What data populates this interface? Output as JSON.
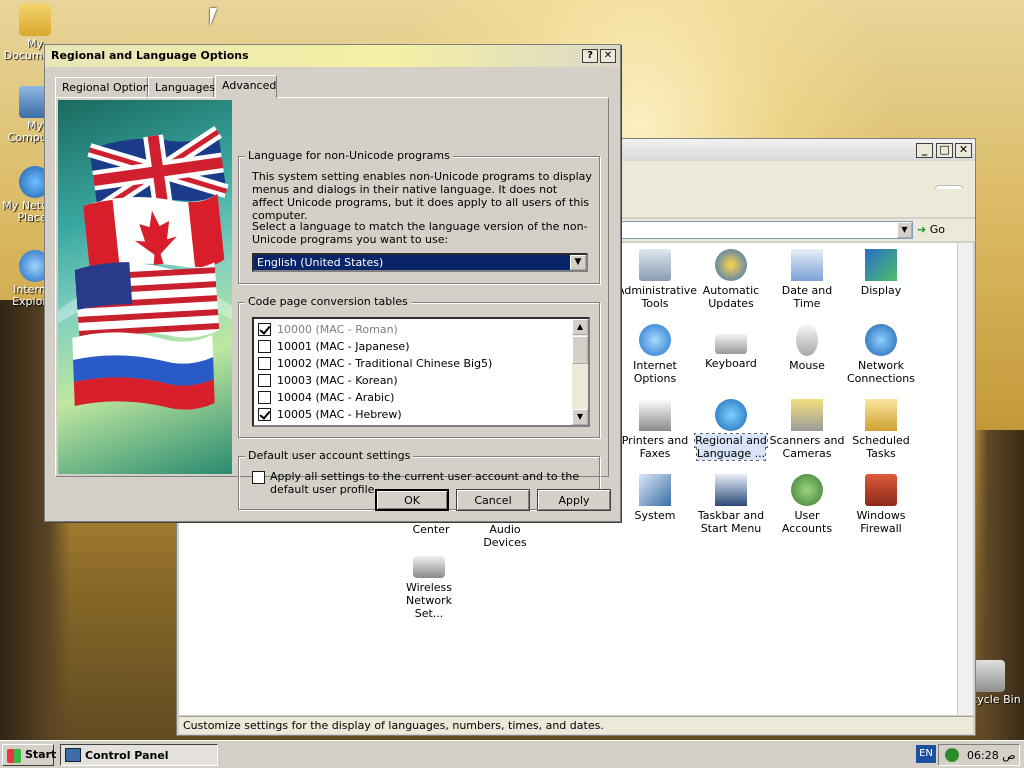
{
  "desktop": {
    "icons": [
      {
        "label": "My Documents",
        "icon": "folder-icon"
      },
      {
        "label": "My Computer",
        "icon": "computer-icon"
      },
      {
        "label": "My Network Places",
        "icon": "network-places-icon"
      },
      {
        "label": "Internet Explorer",
        "icon": "internet-explorer-icon"
      },
      {
        "label": "Recycle Bin",
        "icon": "recycle-bin-icon"
      }
    ]
  },
  "control_panel": {
    "title": "Control Panel",
    "address_go": "Go",
    "status_text": "Customize settings for the display of languages, numbers, times, and dates.",
    "items": [
      {
        "label": "Administrative Tools",
        "icon": "admin-tools-icon"
      },
      {
        "label": "Automatic Updates",
        "icon": "automatic-updates-icon"
      },
      {
        "label": "Date and Time",
        "icon": "date-time-icon"
      },
      {
        "label": "Display",
        "icon": "display-icon"
      },
      {
        "label": "Internet Options",
        "icon": "internet-options-icon"
      },
      {
        "label": "Keyboard",
        "icon": "keyboard-icon"
      },
      {
        "label": "Mouse",
        "icon": "mouse-icon"
      },
      {
        "label": "Network Connections",
        "icon": "network-connections-icon"
      },
      {
        "label": "Printers and Faxes",
        "icon": "printers-icon"
      },
      {
        "label": "Regional and Language ...",
        "icon": "regional-language-icon"
      },
      {
        "label": "Scanners and Cameras",
        "icon": "scanners-icon"
      },
      {
        "label": "Scheduled Tasks",
        "icon": "scheduled-tasks-icon"
      },
      {
        "label": "System",
        "icon": "system-icon"
      },
      {
        "label": "Taskbar and Start Menu",
        "icon": "taskbar-icon"
      },
      {
        "label": "User Accounts",
        "icon": "user-accounts-icon"
      },
      {
        "label": "Windows Firewall",
        "icon": "firewall-icon"
      },
      {
        "label": "Center",
        "icon": ""
      },
      {
        "label": "Audio Devices",
        "icon": ""
      },
      {
        "label": "Wireless Network Set...",
        "icon": "wireless-icon"
      }
    ]
  },
  "dialog": {
    "title": "Regional and Language Options",
    "help_btn": "?",
    "close_btn": "✕",
    "tabs": [
      "Regional Options",
      "Languages",
      "Advanced"
    ],
    "active_tab": "Advanced",
    "non_unicode": {
      "legend": "Language for non-Unicode programs",
      "desc": "This system setting enables non-Unicode programs to display menus and dialogs in their native language. It does not affect Unicode programs, but it does apply to all users of this computer.",
      "prompt": "Select a language to match the language version of the non-Unicode programs you want to use:",
      "selected": "English (United States)"
    },
    "code_page": {
      "legend": "Code page conversion tables",
      "rows": [
        {
          "label": "10000 (MAC - Roman)",
          "checked": true,
          "disabled": true
        },
        {
          "label": "10001 (MAC - Japanese)",
          "checked": false,
          "disabled": false
        },
        {
          "label": "10002 (MAC - Traditional Chinese Big5)",
          "checked": false,
          "disabled": false
        },
        {
          "label": "10003 (MAC - Korean)",
          "checked": false,
          "disabled": false
        },
        {
          "label": "10004 (MAC - Arabic)",
          "checked": false,
          "disabled": false
        },
        {
          "label": "10005 (MAC - Hebrew)",
          "checked": true,
          "disabled": false
        }
      ]
    },
    "default_user": {
      "legend": "Default user account settings",
      "checkbox_label": "Apply all settings to the current user account and to the default user profile"
    },
    "buttons": {
      "ok": "OK",
      "cancel": "Cancel",
      "apply": "Apply"
    }
  },
  "taskbar": {
    "start": "Start",
    "task": "Control Panel",
    "lang": "EN",
    "clock": "06:28 ص"
  }
}
